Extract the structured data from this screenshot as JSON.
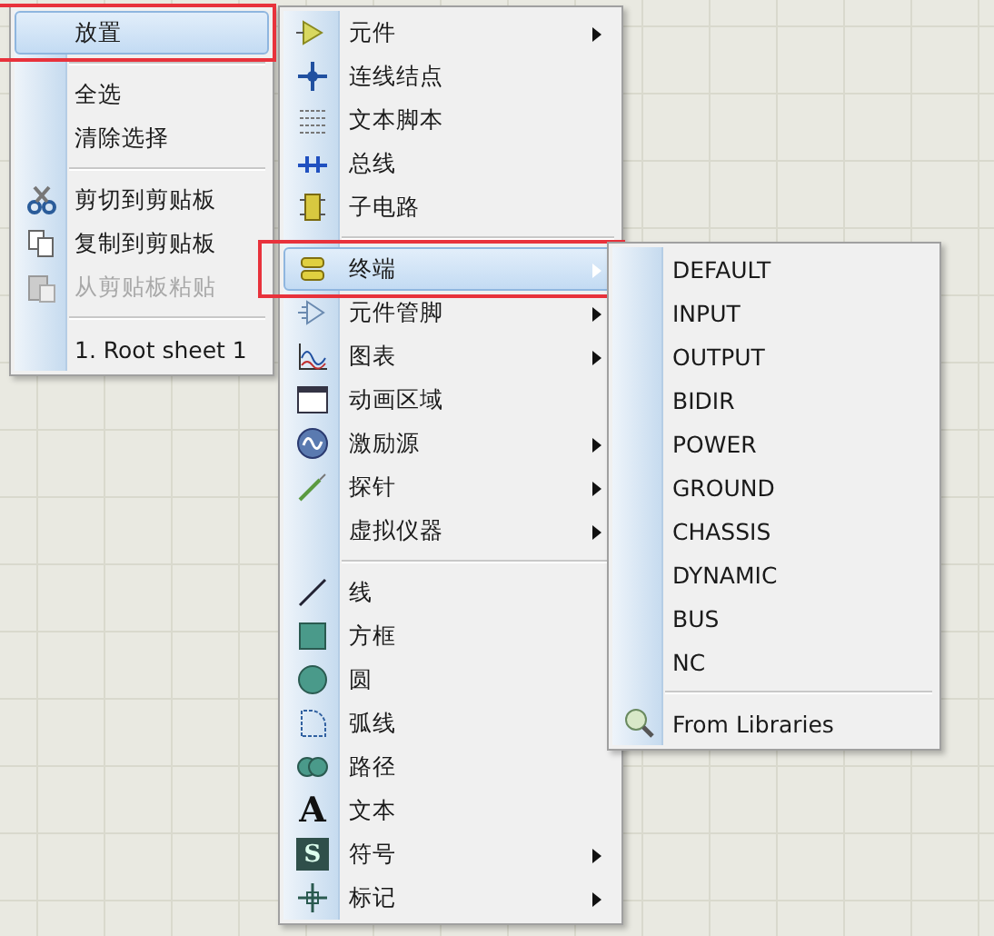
{
  "menus": [
    {
      "groups": [
        [
          {
            "label": "放置",
            "selected": true,
            "disabled": false,
            "framed": true
          }
        ],
        [
          {
            "label": "全选",
            "selected": false,
            "disabled": false,
            "framed": false
          },
          {
            "label": "清除选择",
            "selected": false,
            "disabled": false,
            "framed": false
          }
        ],
        [
          {
            "label": "剪切到剪贴板",
            "selected": false,
            "disabled": false,
            "framed": false
          },
          {
            "label": "复制到剪贴板",
            "selected": false,
            "disabled": false,
            "framed": false
          },
          {
            "label": "从剪贴板粘贴",
            "selected": false,
            "disabled": true,
            "framed": false
          }
        ],
        [
          {
            "label": "1. Root sheet 1",
            "selected": false,
            "disabled": false,
            "framed": false
          }
        ]
      ]
    },
    {
      "groups": [
        [
          {
            "label": "元件",
            "selected": false,
            "submenu": true,
            "framed": false
          },
          {
            "label": "连线结点",
            "selected": false,
            "submenu": false,
            "framed": false
          },
          {
            "label": "文本脚本",
            "selected": false,
            "submenu": false,
            "framed": false
          },
          {
            "label": "总线",
            "selected": false,
            "submenu": false,
            "framed": false
          },
          {
            "label": "子电路",
            "selected": false,
            "submenu": false,
            "framed": false
          }
        ],
        [
          {
            "label": "终端",
            "selected": true,
            "submenu": true,
            "framed": true
          },
          {
            "label": "元件管脚",
            "selected": false,
            "submenu": true,
            "framed": false
          },
          {
            "label": "图表",
            "selected": false,
            "submenu": true,
            "framed": false
          },
          {
            "label": "动画区域",
            "selected": false,
            "submenu": false,
            "framed": false
          },
          {
            "label": "激励源",
            "selected": false,
            "submenu": true,
            "framed": false
          },
          {
            "label": "探针",
            "selected": false,
            "submenu": true,
            "framed": false
          },
          {
            "label": "虚拟仪器",
            "selected": false,
            "submenu": true,
            "framed": false
          }
        ],
        [
          {
            "label": "线",
            "selected": false,
            "submenu": false,
            "framed": false
          },
          {
            "label": "方框",
            "selected": false,
            "submenu": false,
            "framed": false
          },
          {
            "label": "圆",
            "selected": false,
            "submenu": false,
            "framed": false
          },
          {
            "label": "弧线",
            "selected": false,
            "submenu": false,
            "framed": false
          },
          {
            "label": "路径",
            "selected": false,
            "submenu": false,
            "framed": false
          },
          {
            "label": "文本",
            "selected": false,
            "submenu": false,
            "framed": false,
            "icon_char": "A"
          },
          {
            "label": "符号",
            "selected": false,
            "submenu": true,
            "framed": false,
            "icon_char": "S"
          },
          {
            "label": "标记",
            "selected": false,
            "submenu": true,
            "framed": false
          }
        ]
      ]
    },
    {
      "groups": [
        [
          {
            "label": "DEFAULT"
          },
          {
            "label": "INPUT"
          },
          {
            "label": "OUTPUT"
          },
          {
            "label": "BIDIR"
          },
          {
            "label": "POWER"
          },
          {
            "label": "GROUND"
          },
          {
            "label": "CHASSIS"
          },
          {
            "label": "DYNAMIC"
          },
          {
            "label": "BUS"
          },
          {
            "label": "NC"
          }
        ],
        [
          {
            "label": "From Libraries"
          }
        ]
      ]
    }
  ]
}
